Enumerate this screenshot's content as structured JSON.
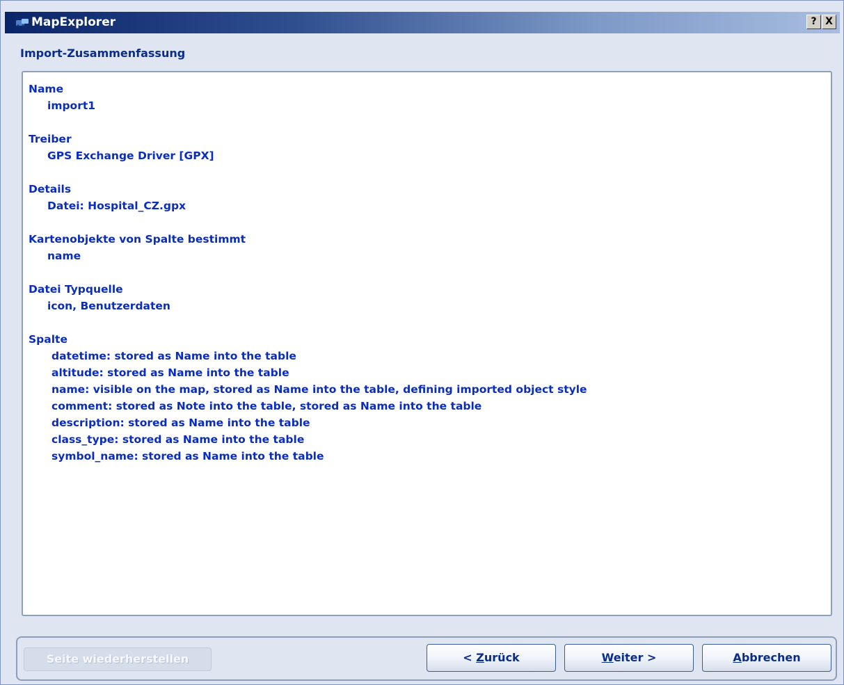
{
  "window": {
    "title": "MapExplorer",
    "help_label": "?",
    "close_label": "X"
  },
  "summary": {
    "heading": "Import-Zusammenfassung",
    "groups": [
      {
        "label": "Name",
        "value": "import1"
      },
      {
        "label": "Treiber",
        "value": "GPS Exchange Driver [GPX]"
      },
      {
        "label": "Details",
        "value": "Datei: Hospital_CZ.gpx"
      },
      {
        "label": "Kartenobjekte von Spalte bestimmt",
        "value": "name"
      },
      {
        "label": "Datei Typquelle",
        "value": "icon, Benutzerdaten"
      }
    ],
    "columns_label": "Spalte",
    "columns": [
      "datetime: stored as Name into the table",
      "altitude: stored as Name into the table",
      "name: visible on the map, stored as Name into the table, defining imported object style",
      "comment: stored as Note into the table, stored as Name into the table",
      "description: stored as Name into the table",
      "class_type: stored as Name into the table",
      "symbol_name: stored as Name into the table"
    ]
  },
  "buttons": {
    "restore": "Seite wiederherstellen",
    "back_prefix": "< ",
    "back_key": "Z",
    "back_rest": "urück",
    "next_key": "W",
    "next_rest": "eiter >",
    "cancel_key": "A",
    "cancel_rest": "bbrechen"
  }
}
